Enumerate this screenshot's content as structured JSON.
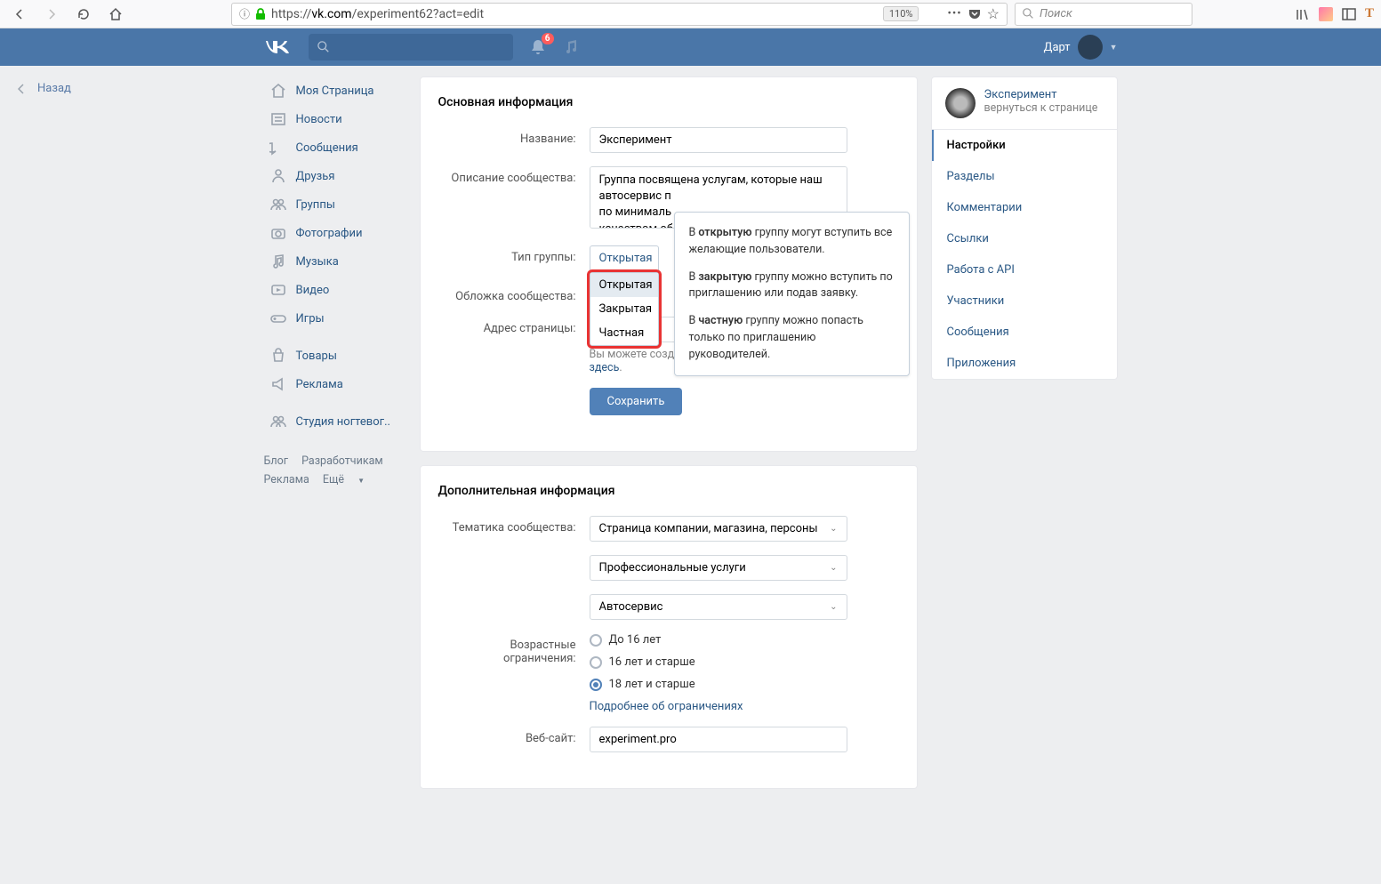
{
  "browser": {
    "url_prefix": "https://",
    "url_domain": "vk.com",
    "url_path": "/experiment62?act=edit",
    "zoom": "110%",
    "search_placeholder": "Поиск"
  },
  "back_button": "Назад",
  "vk_header": {
    "notification_count": "6",
    "username": "Дарт"
  },
  "sidebar": {
    "items": [
      {
        "label": "Моя Страница",
        "icon": "home"
      },
      {
        "label": "Новости",
        "icon": "news"
      },
      {
        "label": "Сообщения",
        "icon": "messages"
      },
      {
        "label": "Друзья",
        "icon": "friends"
      },
      {
        "label": "Группы",
        "icon": "groups"
      },
      {
        "label": "Фотографии",
        "icon": "photos"
      },
      {
        "label": "Музыка",
        "icon": "music"
      },
      {
        "label": "Видео",
        "icon": "video"
      },
      {
        "label": "Игры",
        "icon": "games"
      }
    ],
    "items2": [
      {
        "label": "Товары",
        "icon": "market"
      },
      {
        "label": "Реклама",
        "icon": "ads"
      }
    ],
    "items3": [
      {
        "label": "Студия ногтевог..",
        "icon": "groups"
      }
    ]
  },
  "footer": {
    "blog": "Блог",
    "devs": "Разработчикам",
    "ads": "Реклама",
    "more": "Ещё"
  },
  "main_panel": {
    "title": "Основная информация",
    "name_label": "Название:",
    "name_value": "Эксперимент",
    "desc_label": "Описание сообщества:",
    "desc_value": "Группа посвящена услугам, которые наш автосервис п\nпо минималь\nкачеством об",
    "type_label": "Тип группы:",
    "type_value": "Открытая",
    "type_options": [
      "Открытая",
      "Закрытая",
      "Частная"
    ],
    "cover_label": "Обложка сообщества:",
    "address_label": "Адрес страницы:",
    "sticker_hint1": "Вы можете создать наклейки для Вашего сообщества ",
    "sticker_hint_link": "здесь",
    "save_btn": "Сохранить"
  },
  "tooltip": {
    "p1a": "В ",
    "p1b": "открытую",
    "p1c": " группу могут вступить все желающие пользователи.",
    "p2a": "В ",
    "p2b": "закрытую",
    "p2c": " группу можно вступить по приглашению или подав заявку.",
    "p3a": "В ",
    "p3b": "частную",
    "p3c": " группу можно попасть только по приглашению руководителей."
  },
  "extra_panel": {
    "title": "Дополнительная информация",
    "topic_label": "Тематика сообщества:",
    "topic_value": "Страница компании, магазина, персоны",
    "subtopic_value": "Профессиональные  услуги",
    "subtopic2_value": "Автосервис",
    "age_label": "Возрастные ограничения:",
    "age_options": [
      "До 16 лет",
      "16 лет и старше",
      "18 лет и старше"
    ],
    "age_link": "Подробнее об ограничениях",
    "website_label": "Веб-сайт:",
    "website_value": "experiment.pro"
  },
  "right": {
    "community_name": "Эксперимент",
    "back_link": "вернуться к странице",
    "nav": [
      "Настройки",
      "Разделы",
      "Комментарии",
      "Ссылки",
      "Работа с API",
      "Участники",
      "Сообщения",
      "Приложения"
    ]
  }
}
